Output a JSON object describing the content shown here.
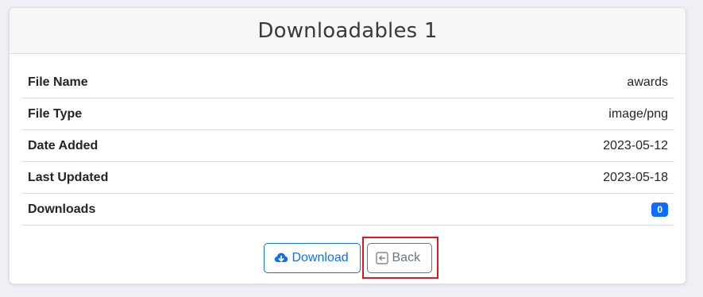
{
  "page": {
    "title": "Downloadables 1"
  },
  "details": [
    {
      "label": "File Name",
      "value": "awards"
    },
    {
      "label": "File Type",
      "value": "image/png"
    },
    {
      "label": "Date Added",
      "value": "2023-05-12"
    },
    {
      "label": "Last Updated",
      "value": "2023-05-18"
    },
    {
      "label": "Downloads",
      "value": "0"
    }
  ],
  "actions": {
    "download_label": "Download",
    "back_label": "Back"
  },
  "colors": {
    "primary": "#0d6efd",
    "secondary": "#6c757d",
    "highlight": "#e3141b"
  },
  "icons": {
    "download": "cloud-download-icon",
    "back": "arrow-left-square-icon"
  }
}
